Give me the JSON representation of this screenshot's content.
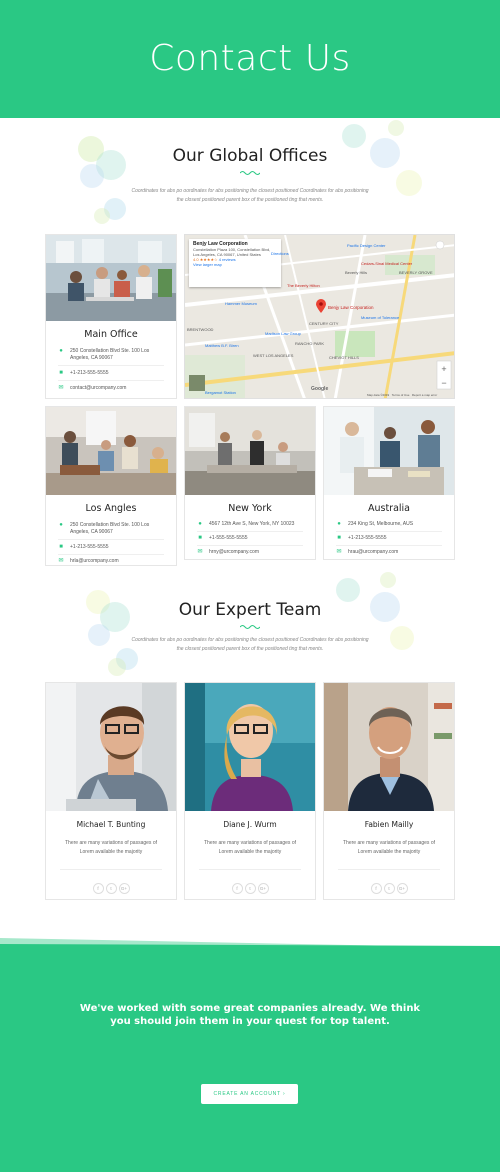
{
  "hero": {
    "title": "Contact Us"
  },
  "offices_section": {
    "title": "Our Global Offices",
    "subtitle": "Coordinates for abs po oordinates for abs positioning the closest positioned Coordinates for abs positioning the closest positioned parent box of the positioned ting that ments."
  },
  "offices": [
    {
      "name": "Main Office",
      "address": "250 Constellation Blvd Ste. 100 Los Angeles, CA 90067",
      "phone": "+1-213-555-5555",
      "email": "contact@urcompany.com"
    },
    {
      "name": "Los Angles",
      "address": "250 Constellation Blvd Ste. 100 Los Angeles, CA 90067",
      "phone": "+1-213-555-5555",
      "email": "hrla@urcompany.com"
    },
    {
      "name": "New York",
      "address": "4567 12th Ave S, New York, NY 10023",
      "phone": "+1-555-555-5555",
      "email": "hrny@urcompany.com"
    },
    {
      "name": "Australia",
      "address": "234 King St, Melbourne, AUS",
      "phone": "+1-213-555-5555",
      "email": "hrau@urcompany.com"
    }
  ],
  "map": {
    "place_name": "Benjy Law Corporation",
    "place_address": "Constellation Plaza 100, Constellation Blvd, Los Angeles, CA 90067, United States",
    "rating": "4.0",
    "stars": "★★★★☆",
    "reviews": "4 reviews",
    "view_larger": "View larger map",
    "directions": "Directions",
    "pin_label": "Benjy Law Corporation",
    "labels": [
      "Pacific Design Center",
      "Cedars-Sinai Medical Center",
      "Beverly Hills",
      "BEVERLY GROVE",
      "Hammer Museum",
      "Museum of Tolerance",
      "Madison Law Group",
      "CENTURY CITY",
      "RANCHO PARK",
      "CHEVIOT HILLS",
      "Matthew B.F. Biren",
      "WEST LOS ANGELES",
      "BRENTWOOD",
      "The Beverly Hilton",
      "CENTURY CITY",
      "Bergamot Station",
      "Google",
      "Map data ©2019",
      "Terms of Use",
      "Report a map error"
    ]
  },
  "team_section": {
    "title": "Our Expert Team",
    "subtitle": "Coordinates for abs po oordinates for abs positioning the closest positioned Coordinates for abs positioning the closest positioned parent box of the positioned ting that ments."
  },
  "team": [
    {
      "name": "Michael T. Bunting",
      "desc": "There are many variations of passages of Lorem available the majority"
    },
    {
      "name": "Diane J. Wurm",
      "desc": "There are many variations of passages of Lorem available the majority"
    },
    {
      "name": "Fabien Mailly",
      "desc": "There are many variations of passages of Lorem available the majority"
    }
  ],
  "social": {
    "facebook": "f",
    "twitter": "t",
    "google": "G+"
  },
  "footer": {
    "tagline": "We've worked with some great companies already. We think you should join them in your quest for top talent.",
    "button": "CREATE AN ACCOUNT  ›"
  },
  "colors": {
    "accent": "#2ac884",
    "pin": "#ea4335"
  }
}
